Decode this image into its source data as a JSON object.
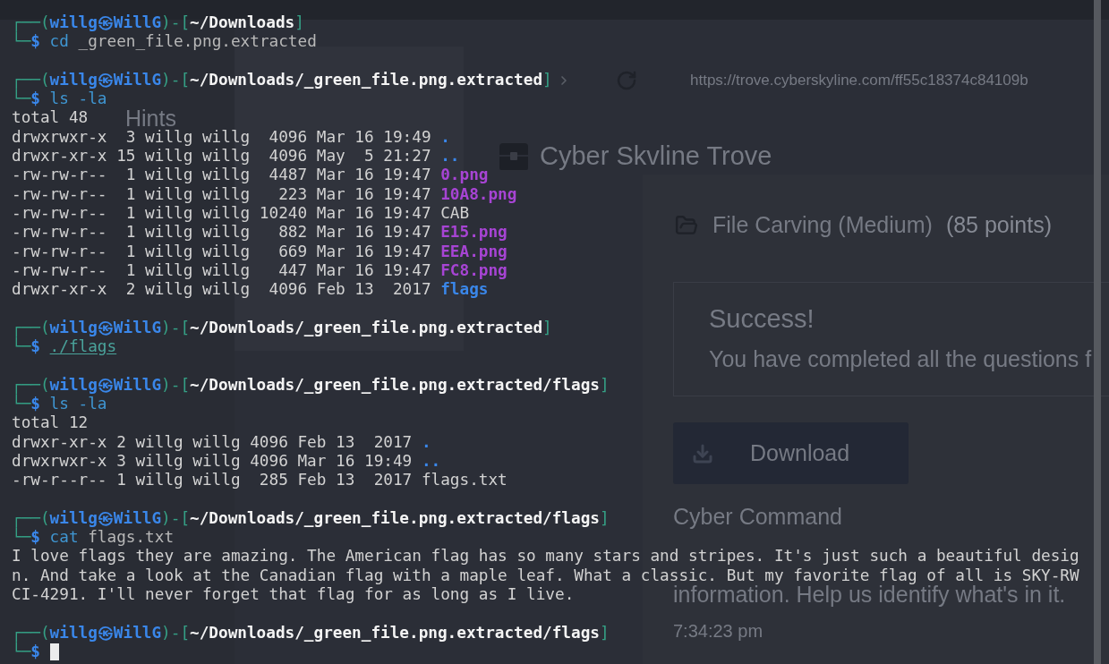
{
  "browser": {
    "url": "https://trove.cyberskyline.com/ff55c18374c84109b",
    "sidebar_items": [
      {
        "label": "Hints"
      }
    ],
    "site_title": "Cyber Skvline Trove",
    "challenge": {
      "title": "File Carving (Medium)",
      "points": "(85 points)",
      "alert": {
        "title": "Success!",
        "message": "You have completed all the questions f"
      },
      "download_button": "Download",
      "section_title": "Cyber Command",
      "description": "information. Help us identify what's in it.",
      "time": "7:34:23 pm"
    }
  },
  "terminal": {
    "blocks": [
      {
        "prompt": [
          "┌──(",
          "willg㉿WillG",
          ")-[",
          "~/Downloads",
          "]"
        ],
        "marker": [
          "└─",
          "$"
        ],
        "command": [
          {
            "text": "cd",
            "kind": "command"
          },
          {
            "text": "_green_file.png.extracted",
            "kind": "argument"
          }
        ]
      },
      {
        "prompt": [
          "┌──(",
          "willg㉿WillG",
          ")-[",
          "~/Downloads/_green_file.png.extracted",
          "]"
        ],
        "marker": [
          "└─",
          "$"
        ],
        "command": [
          {
            "text": "ls",
            "kind": "command"
          },
          {
            "text": "-la",
            "kind": "option"
          }
        ],
        "output": [
          {
            "text": "total 48"
          },
          {
            "text": "drwxrwxr-x  3 willg willg  4096 Mar 16 19:49",
            "name": ".",
            "kind": "dir"
          },
          {
            "text": "drwxr-xr-x 15 willg willg  4096 May  5 21:27",
            "name": "..",
            "kind": "dir"
          },
          {
            "text": "-rw-rw-r--  1 willg willg  4487 Mar 16 19:47",
            "name": "0.png",
            "kind": "image"
          },
          {
            "text": "-rw-rw-r--  1 willg willg   223 Mar 16 19:47",
            "name": "10A8.png",
            "kind": "image"
          },
          {
            "text": "-rw-rw-r--  1 willg willg 10240 Mar 16 19:47",
            "name": "CAB",
            "kind": "file"
          },
          {
            "text": "-rw-rw-r--  1 willg willg   882 Mar 16 19:47",
            "name": "E15.png",
            "kind": "image"
          },
          {
            "text": "-rw-rw-r--  1 willg willg   669 Mar 16 19:47",
            "name": "EEA.png",
            "kind": "image"
          },
          {
            "text": "-rw-rw-r--  1 willg willg   447 Mar 16 19:47",
            "name": "FC8.png",
            "kind": "image"
          },
          {
            "text": "drwxr-xr-x  2 willg willg  4096 Feb 13  2017",
            "name": "flags",
            "kind": "dir"
          }
        ]
      },
      {
        "prompt": [
          "┌──(",
          "willg㉿WillG",
          ")-[",
          "~/Downloads/_green_file.png.extracted",
          "]"
        ],
        "marker": [
          "└─",
          "$"
        ],
        "command": [
          {
            "text": "./flags",
            "kind": "path"
          }
        ]
      },
      {
        "prompt": [
          "┌──(",
          "willg㉿WillG",
          ")-[",
          "~/Downloads/_green_file.png.extracted/flags",
          "]"
        ],
        "marker": [
          "└─",
          "$"
        ],
        "command": [
          {
            "text": "ls",
            "kind": "command"
          },
          {
            "text": "-la",
            "kind": "option"
          }
        ],
        "output": [
          {
            "text": "total 12"
          },
          {
            "text": "drwxr-xr-x 2 willg willg 4096 Feb 13  2017",
            "name": ".",
            "kind": "dir"
          },
          {
            "text": "drwxrwxr-x 3 willg willg 4096 Mar 16 19:49",
            "name": "..",
            "kind": "dir"
          },
          {
            "text": "-rw-r--r-- 1 willg willg  285 Feb 13  2017",
            "name": "flags.txt",
            "kind": "file"
          }
        ]
      },
      {
        "prompt": [
          "┌──(",
          "willg㉿WillG",
          ")-[",
          "~/Downloads/_green_file.png.extracted/flags",
          "]"
        ],
        "marker": [
          "└─",
          "$"
        ],
        "command": [
          {
            "text": "cat",
            "kind": "command"
          },
          {
            "text": "flags.txt",
            "kind": "argument"
          }
        ],
        "output": [
          {
            "text": "I love flags they are amazing. The American flag has so many stars and stripes. It's just such a beautiful desig"
          },
          {
            "text": "n. And take a look at the Canadian flag with a maple leaf. What a classic. But my favorite flag of all is SKY-RW"
          },
          {
            "text": "CI-4291. I'll never forget that flag for as long as I live."
          }
        ]
      }
    ],
    "current": {
      "prompt": [
        "┌──(",
        "willg㉿WillG",
        ")-[",
        "~/Downloads/_green_file.png.extracted/flags",
        "]"
      ],
      "marker": [
        "└─",
        "$"
      ],
      "cursor": true
    }
  }
}
